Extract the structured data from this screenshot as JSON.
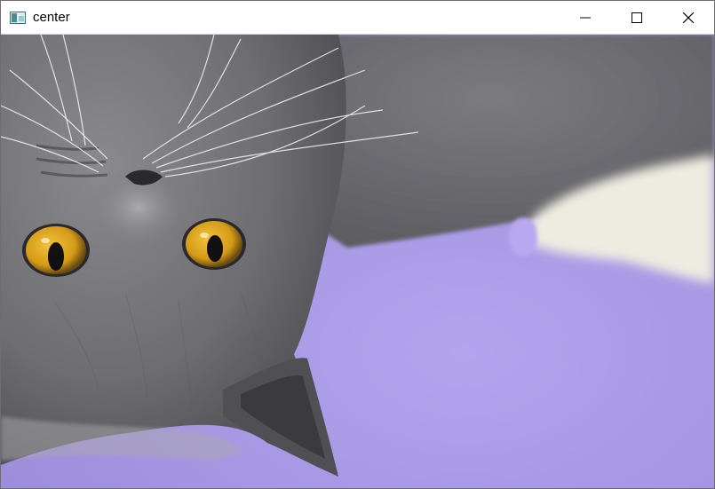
{
  "window": {
    "title": "center",
    "controls": {
      "minimize": "minimize-icon",
      "maximize": "maximize-icon",
      "close": "close-icon"
    }
  },
  "image": {
    "subject_icon": "cat-photo",
    "colors": {
      "background": "#a99ae6",
      "fur": "#707074",
      "eyes": "#d7a21f"
    }
  }
}
